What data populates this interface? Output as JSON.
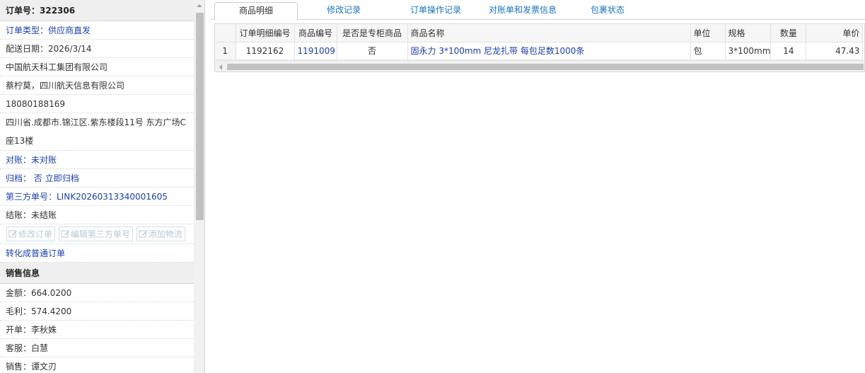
{
  "left": {
    "order_header": "订单号：322306",
    "order_type": "订单类型：供应商直发",
    "delivery_date": "配送日期：2026/3/14",
    "company": "中国航天科工集团有限公司",
    "contact": "蔡柠莫，四川航天信息有限公司",
    "phone": "18080188169",
    "address": "四川省.成都市.锦江区.紫东楼段11号 东方广场C座13楼",
    "reconcile": "对账：未对账",
    "archive_label": "归档：",
    "archive_value": "否",
    "archive_link": "立即归档",
    "third_party": "第三方单号：LINK20260313340001605",
    "settle": "结账：未结账",
    "buttons": [
      "修改订单",
      "编辑第三方单号",
      "添加物流"
    ],
    "convert_link": "转化成普通订单",
    "sales_header": "销售信息",
    "amount": "金额：664.0200",
    "gross_profit": "毛利：574.4200",
    "opener": "开单：李秋姝",
    "service": "客服：白慧",
    "sales": "销售：谭文刃"
  },
  "tabs": [
    "商品明细",
    "修改记录",
    "订单操作记录",
    "对账单和发票信息",
    "包裹状态"
  ],
  "active_tab": 0,
  "grid": {
    "columns": [
      "订单明细编号",
      "商品编号",
      "是否是专柜商品",
      "商品名称",
      "单位",
      "规格",
      "数量",
      "单价"
    ],
    "rows": [
      {
        "index": "1",
        "detail_id": "1192162",
        "product_id": "1191009",
        "counter": "否",
        "name": "固永力 3*100mm 尼龙扎带 每包足数1000条",
        "unit": "包",
        "spec": "3*100mm",
        "qty": "14",
        "price": "47.43"
      }
    ]
  },
  "colors": {
    "link": "#1a3fb3",
    "tab_text": "#1a75c0",
    "header_bg": "#efefef"
  }
}
